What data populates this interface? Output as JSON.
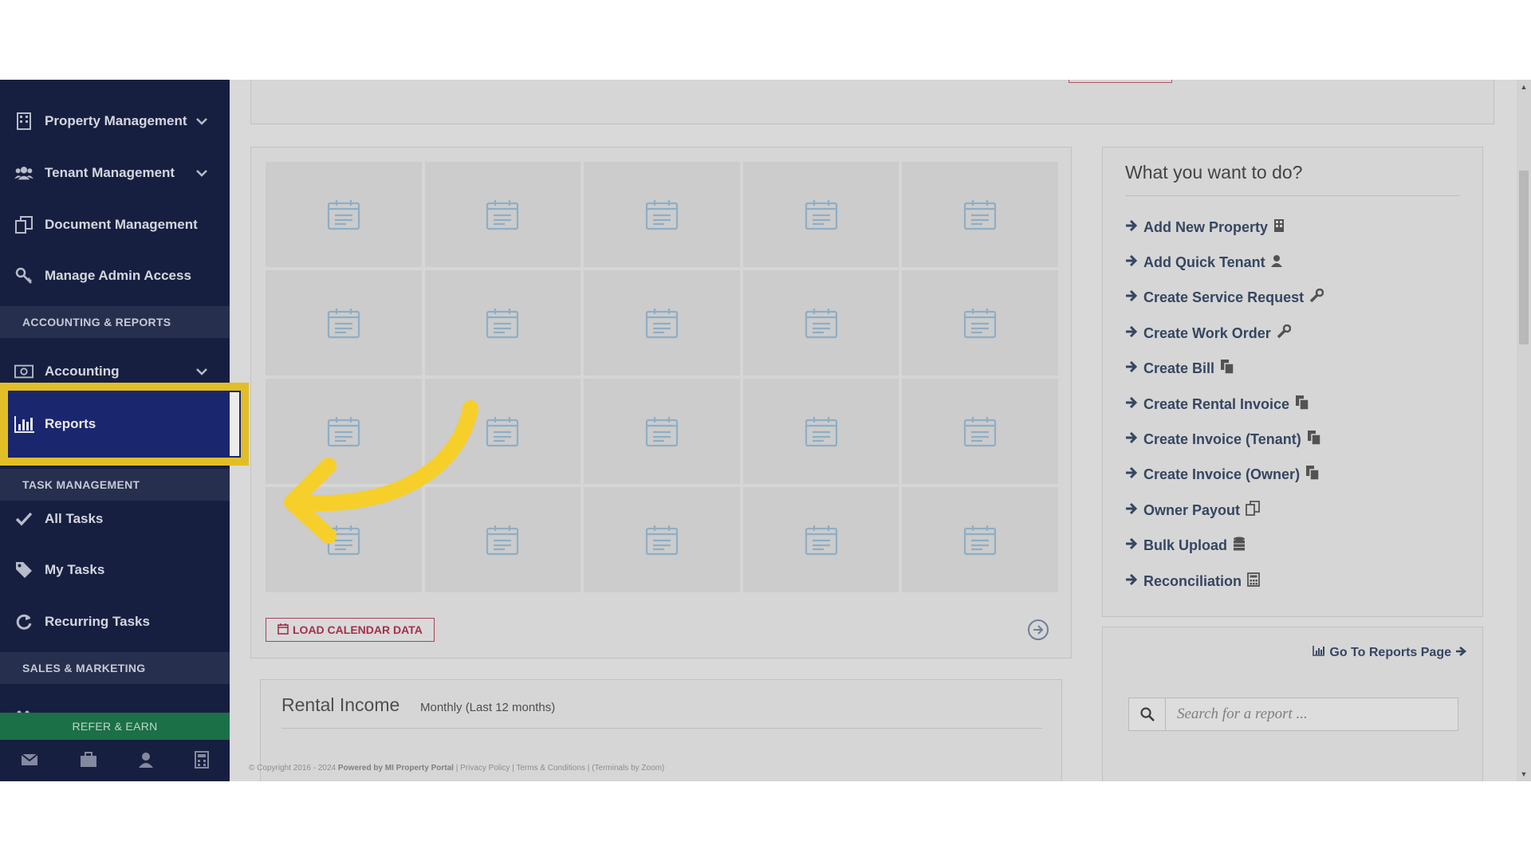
{
  "sidebar": {
    "items": [
      {
        "label": "Property Management",
        "icon": "building-icon",
        "has_dropdown": true
      },
      {
        "label": "Tenant Management",
        "icon": "users-icon",
        "has_dropdown": true
      },
      {
        "label": "Document Management",
        "icon": "documents-icon",
        "has_dropdown": false
      },
      {
        "label": "Manage Admin Access",
        "icon": "key-icon",
        "has_dropdown": false
      }
    ],
    "section_accounting": "ACCOUNTING & REPORTS",
    "accounting": {
      "label": "Accounting",
      "icon": "money-icon"
    },
    "reports": {
      "label": "Reports",
      "icon": "bar-chart-icon",
      "active": true
    },
    "section_tasks": "TASK MANAGEMENT",
    "tasks": [
      {
        "label": "All Tasks",
        "icon": "check-icon"
      },
      {
        "label": "My Tasks",
        "icon": "tag-icon"
      },
      {
        "label": "Recurring Tasks",
        "icon": "refresh-icon"
      }
    ],
    "section_sales": "SALES & MARKETING",
    "refer_label": "REFER & EARN",
    "footer_icons": [
      "envelope-icon",
      "briefcase-icon",
      "user-icon",
      "calculator-icon"
    ]
  },
  "calendar": {
    "load_button": "LOAD CALENDAR DATA"
  },
  "actions": {
    "title": "What you want to do?",
    "items": [
      {
        "label": "Add New Property",
        "icon": "building-icon"
      },
      {
        "label": "Add Quick Tenant",
        "icon": "user-icon"
      },
      {
        "label": "Create Service Request",
        "icon": "wrench-icon"
      },
      {
        "label": "Create Work Order",
        "icon": "wrench-icon"
      },
      {
        "label": "Create Bill",
        "icon": "copy-icon"
      },
      {
        "label": "Create Rental Invoice",
        "icon": "copy-icon"
      },
      {
        "label": "Create Invoice (Tenant)",
        "icon": "copy-icon"
      },
      {
        "label": "Create Invoice (Owner)",
        "icon": "copy-icon"
      },
      {
        "label": "Owner Payout",
        "icon": "copy-outline-icon"
      },
      {
        "label": "Bulk Upload",
        "icon": "database-icon"
      },
      {
        "label": "Reconciliation",
        "icon": "calculator-icon"
      }
    ]
  },
  "reports_box": {
    "goto_label": "Go To Reports Page",
    "search_placeholder": "Search for a report ..."
  },
  "rental": {
    "title": "Rental Income",
    "subtitle": "Monthly (Last 12 months)"
  },
  "footer": {
    "copyright": "© Copyright 2016 - 2024",
    "powered": "Powered by MI Property Portal",
    "privacy": "Privacy Policy",
    "terms": "Terms & Conditions",
    "feedback": "(Terminals by Zoom)"
  },
  "colors": {
    "sidebar_bg": "#1a2246",
    "highlight": "#f6cf2a",
    "accent_red": "#b03552",
    "link": "#3b4c6a"
  }
}
